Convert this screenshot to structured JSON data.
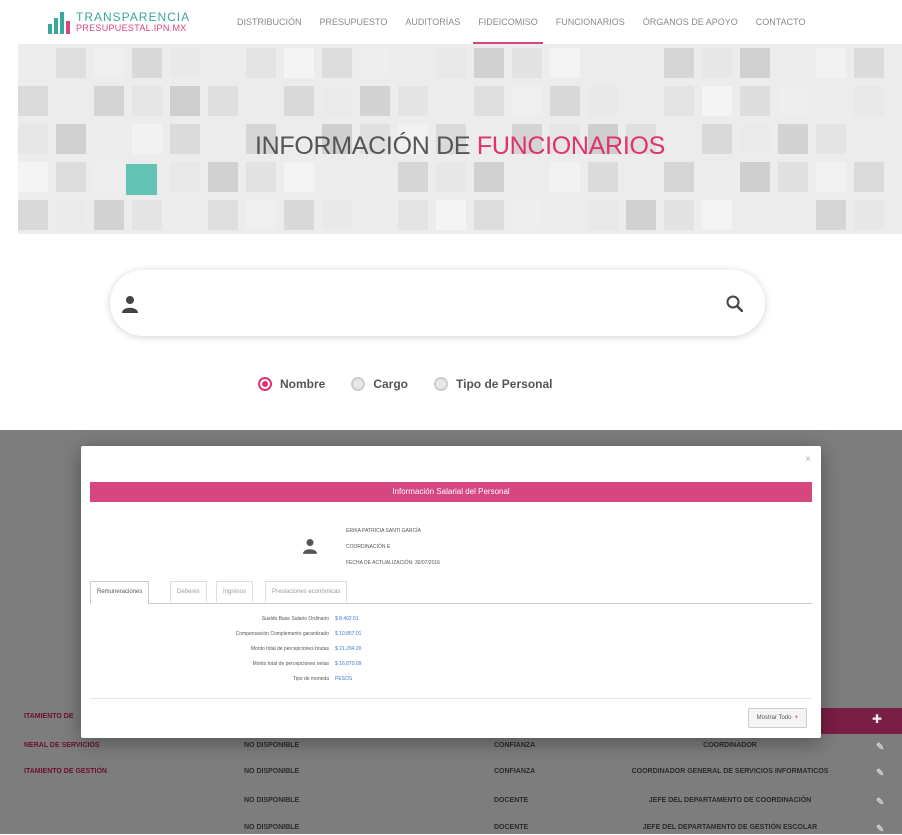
{
  "brand": {
    "line1": "TRANSPARENCIA",
    "line2": "PRESUPUESTAL.IPN.MX"
  },
  "nav": {
    "items": [
      {
        "label": "DISTRIBUCIÓN"
      },
      {
        "label": "PRESUPUESTO"
      },
      {
        "label": "AUDITORÍAS"
      },
      {
        "label": "FIDEICOMISO"
      },
      {
        "label": "FUNCIONARIOS"
      },
      {
        "label": "ÓRGANOS DE APOYO"
      },
      {
        "label": "CONTACTO"
      }
    ],
    "active_index": 3
  },
  "hero": {
    "title_plain": "INFORMACIÓN DE",
    "title_accent": "FUNCIONARIOS"
  },
  "search": {
    "value": ""
  },
  "filters": [
    {
      "label": "Nombre",
      "checked": true
    },
    {
      "label": "Cargo",
      "checked": false
    },
    {
      "label": "Tipo de Personal",
      "checked": false
    }
  ],
  "modal": {
    "close": "×",
    "header": "Información Salarial del Personal",
    "person": {
      "name": "ERIKA PATRICIA SANTI GARCÍA",
      "line2": "COORDINACIÓN E",
      "line3": "FECHA DE ACTUALIZACIÓN: 30/07/2016"
    },
    "tabs": [
      {
        "label": "Remuneraciones"
      },
      {
        "label": "Deberes"
      },
      {
        "label": "Ingresos"
      },
      {
        "label": "Prestaciones económicas"
      }
    ],
    "salary": [
      {
        "label": "Sueldo Base Salario Ordinario",
        "value": "$ 8,402.51"
      },
      {
        "label": "Compensación Complemento garantizado",
        "value": "$ 10,857.01"
      },
      {
        "label": "Monto total de percepciones brutas",
        "value": "$ 21,294.20"
      },
      {
        "label": "Monto total de percepciones netas",
        "value": "$ 16,870.09"
      },
      {
        "label": "Tipo de moneda",
        "value": "PESOS"
      }
    ],
    "show_all": "Mostrar Todo",
    "show_all_icon": "+"
  },
  "background_table": {
    "rows": [
      {
        "c1": "ITAMIENTO DE",
        "c2": "",
        "c3": "",
        "c4": ""
      },
      {
        "c1": "NERAL DE SERVICIOS",
        "c2": "NO DISPONIBLE",
        "c3": "CONFIANZA",
        "c4": "COORDINADOR"
      },
      {
        "c1": "ITAMIENTO DE GESTIÓN",
        "c2": "NO DISPONIBLE",
        "c3": "CONFIANZA",
        "c4": "COORDINADOR GENERAL DE SERVICIOS INFORMATICOS"
      },
      {
        "c1": "",
        "c2": "NO DISPONIBLE",
        "c3": "DOCENTE",
        "c4": "JEFE DEL DEPARTAMENTO DE COORDINACIÓN"
      },
      {
        "c1": "",
        "c2": "NO DISPONIBLE",
        "c3": "DOCENTE",
        "c4": "JEFE DEL DEPARTAMENTO DE GESTIÓN ESCOLAR"
      }
    ]
  }
}
